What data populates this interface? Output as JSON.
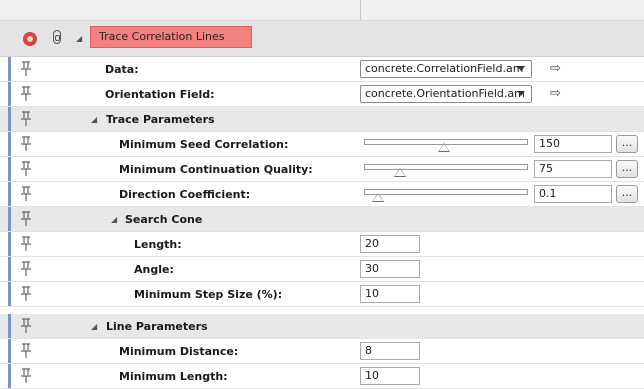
{
  "module": {
    "label": "Trace Correlation Lines",
    "icons": [
      "gear-icon",
      "link-icon"
    ]
  },
  "ellipsis_label": "...",
  "arrow_glyph": "⇨",
  "rows": {
    "data": {
      "label": "Data:",
      "value": "concrete.CorrelationField.am"
    },
    "orientation": {
      "label": "Orientation Field:",
      "value": "concrete.OrientationField.am"
    },
    "trace_params": {
      "label": "Trace Parameters"
    },
    "min_seed": {
      "label": "Minimum Seed Correlation:",
      "value": "150",
      "slider_level": 0.45
    },
    "min_cont": {
      "label": "Minimum Continuation Quality:",
      "value": "75",
      "slider_level": 0.18
    },
    "dir_coef": {
      "label": "Direction Coefficient:",
      "value": "0.1",
      "slider_level": 0.05
    },
    "search_cone": {
      "label": "Search Cone"
    },
    "length": {
      "label": "Length:",
      "value": "20"
    },
    "angle": {
      "label": "Angle:",
      "value": "30"
    },
    "min_step": {
      "label": "Minimum Step Size (%):",
      "value": "10"
    },
    "line_params": {
      "label": "Line Parameters"
    },
    "min_distance": {
      "label": "Minimum Distance:",
      "value": "8"
    },
    "min_length": {
      "label": "Minimum Length:",
      "value": "10"
    }
  },
  "colors": {
    "module_label_bg": "#f58080",
    "port_bar": "#7b93c3",
    "group_bg": "#e7e8ea",
    "gear": "#d6443e"
  }
}
